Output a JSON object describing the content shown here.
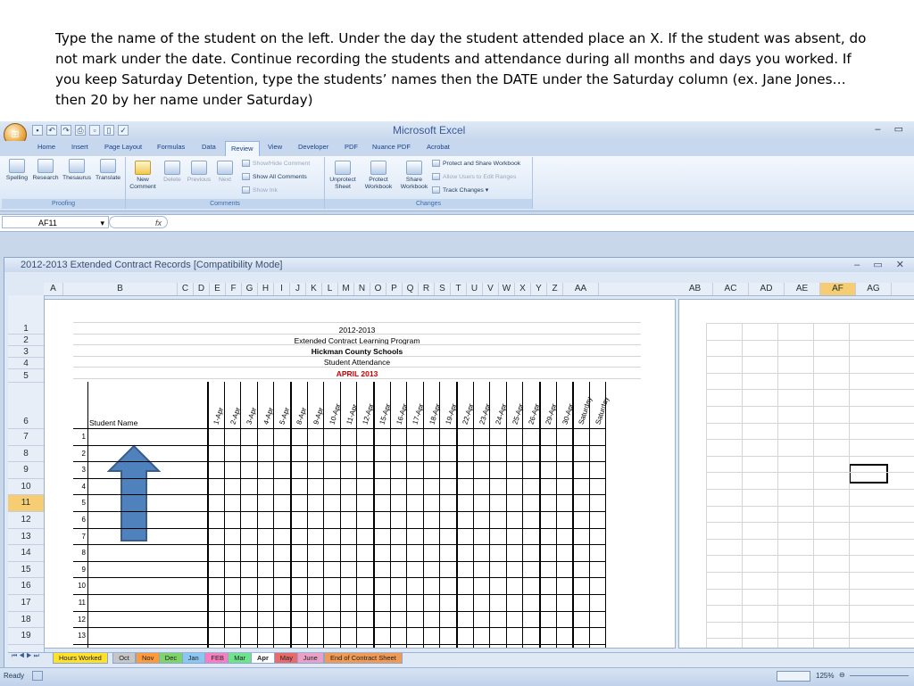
{
  "instructions": "Type the name of the student on the left.  Under the day the student attended place an X.  If the student was absent, do not mark under the date.  Continue recording the students and attendance during all months and days you worked.   If you keep Saturday Detention, type the students’ names then the DATE under the Saturday column (ex. Jane Jones… then 20 by her name under Saturday)",
  "app": {
    "title": "Microsoft Excel",
    "tabs": [
      "Home",
      "Insert",
      "Page Layout",
      "Formulas",
      "Data",
      "Review",
      "View",
      "Developer",
      "PDF",
      "Nuance PDF",
      "Acrobat"
    ],
    "active_tab": "Review"
  },
  "ribbon": {
    "proofing": {
      "label": "Proofing",
      "buttons": [
        "Spelling",
        "Research",
        "Thesaurus",
        "Translate"
      ]
    },
    "comments": {
      "label": "Comments",
      "new_comment": "New Comment",
      "delete": "Delete",
      "previous": "Previous",
      "next": "Next",
      "show_hide": "Show/Hide Comment",
      "show_all": "Show All Comments",
      "show_ink": "Show Ink"
    },
    "changes": {
      "label": "Changes",
      "unprotect_sheet": "Unprotect Sheet",
      "protect_workbook": "Protect Workbook",
      "share_workbook": "Share Workbook",
      "protect_share": "Protect and Share Workbook",
      "allow_users": "Allow Users to Edit Ranges",
      "track_changes": "Track Changes"
    }
  },
  "formula_bar": {
    "name_box": "AF11",
    "fx": "fx"
  },
  "workbook": {
    "title": "2012-2013 Extended Contract Records  [Compatibility Mode]",
    "columns": [
      "A",
      "B",
      "C",
      "D",
      "E",
      "F",
      "G",
      "H",
      "I",
      "J",
      "K",
      "L",
      "M",
      "N",
      "O",
      "P",
      "Q",
      "R",
      "S",
      "T",
      "U",
      "V",
      "W",
      "X",
      "Y",
      "Z",
      "AA"
    ],
    "columns_right": [
      "AB",
      "AC",
      "AD",
      "AE",
      "AF",
      "AG"
    ],
    "selected_column": "AF",
    "rows": [
      "1",
      "2",
      "3",
      "4",
      "5",
      "6",
      "7",
      "8",
      "9",
      "10",
      "11",
      "12",
      "13",
      "14",
      "15",
      "16",
      "17",
      "18",
      "19"
    ],
    "selected_row": "11"
  },
  "sheet": {
    "year": "2012-2013",
    "program": "Extended Contract Learning Program",
    "school": "Hickman County Schools",
    "subtitle": "Student Attendance",
    "month": "APRIL 2013",
    "student_header": "Student Name",
    "dates": [
      "1-Apr",
      "2-Apr",
      "3-Apr",
      "4-Apr",
      "5-Apr",
      "8-Apr",
      "9-Apr",
      "10-Apr",
      "11-Apr",
      "12-Apr",
      "15-Apr",
      "16-Apr",
      "17-Apr",
      "18-Apr",
      "19-Apr",
      "22-Apr",
      "23-Apr",
      "24-Apr",
      "25-Apr",
      "26-Apr",
      "29-Apr",
      "30-Apr",
      "Saturday",
      "Saturday"
    ],
    "student_numbers": [
      "1",
      "2",
      "3",
      "4",
      "5",
      "6",
      "7",
      "8",
      "9",
      "10",
      "11",
      "12",
      "13"
    ]
  },
  "sheet_tabs": [
    "Hours Worked",
    "Oct",
    "Nov",
    "Dec",
    "Jan",
    "FEB",
    "Mar",
    "Apr",
    "May",
    "June",
    "End of Contract Sheet"
  ],
  "active_sheet_tab": "Apr",
  "status": {
    "ready": "Ready",
    "zoom": "125%"
  },
  "colors": {
    "accent_selected": "#f7cd73",
    "month_red": "#cc0000",
    "arrow_blue": "#4f81bd"
  }
}
